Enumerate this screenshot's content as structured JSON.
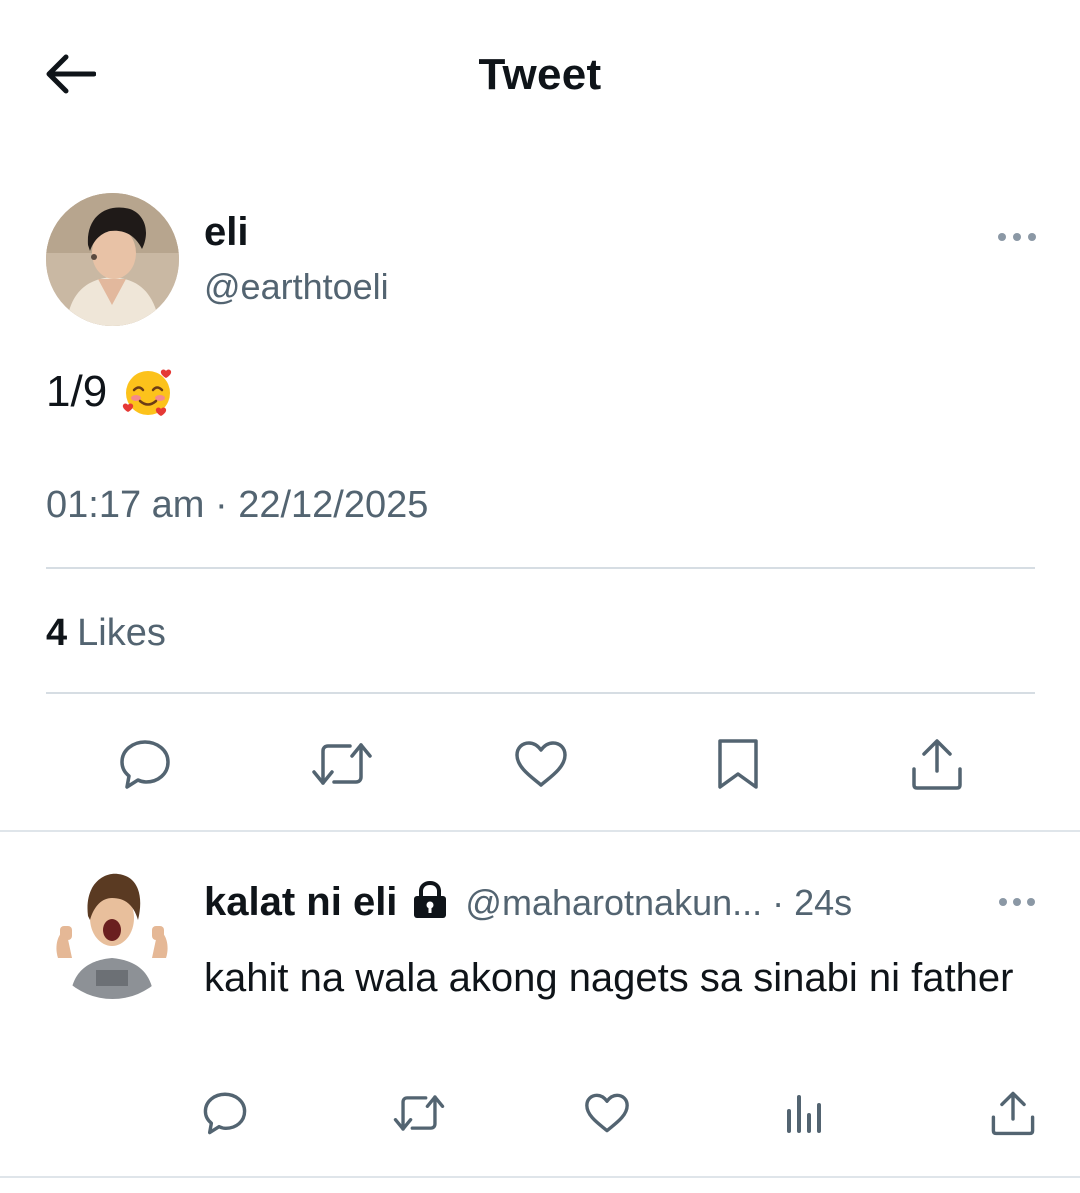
{
  "header": {
    "title": "Tweet",
    "back_icon": "arrow-left-icon"
  },
  "tweet": {
    "author_name": "eli",
    "author_handle": "@earthtoeli",
    "text": "1/9",
    "emoji": "smiling-face-with-hearts",
    "timestamp": "01:17 am · 22/12/2025",
    "likes_count": "4",
    "likes_label": "Likes",
    "actions": [
      "reply-icon",
      "retweet-icon",
      "like-icon",
      "bookmark-icon",
      "share-icon"
    ]
  },
  "reply": {
    "author_name": "kalat ni eli",
    "protected_icon": "lock-icon",
    "author_handle": "@maharotnakun...",
    "time": "· 24s",
    "text": "kahit na wala akong nagets sa sinabi ni father",
    "actions": [
      "reply-icon",
      "retweet-icon",
      "like-icon",
      "views-icon",
      "share-icon"
    ]
  },
  "colors": {
    "text_primary": "#0f1419",
    "text_secondary": "#536471",
    "divider": "#d6dde3",
    "icon": "#536471"
  }
}
